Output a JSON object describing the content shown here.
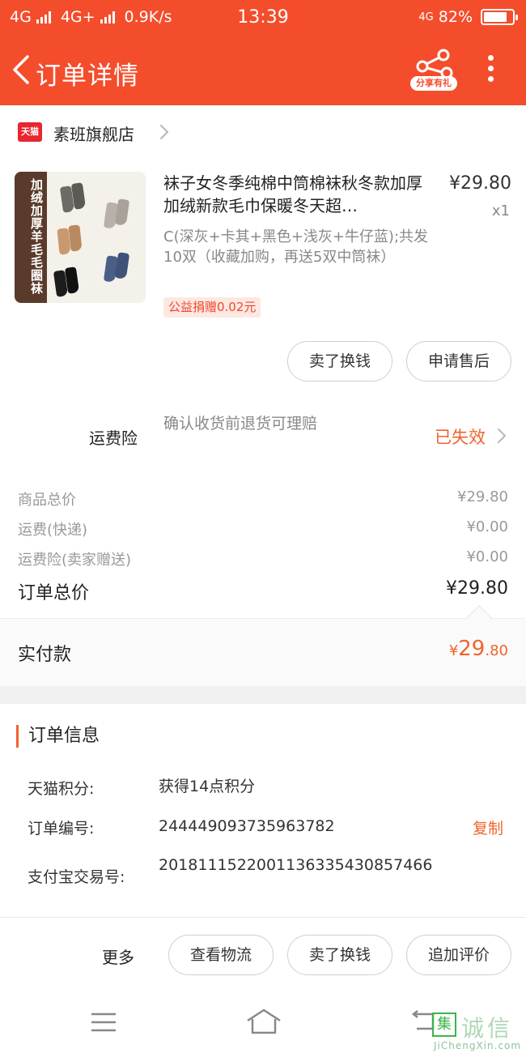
{
  "status_bar": {
    "network1": "4G",
    "network2": "4G+",
    "speed": "0.9K/s",
    "time": "13:39",
    "network3": "4G",
    "battery": "82%"
  },
  "nav": {
    "title": "订单详情",
    "share_label": "分享有礼",
    "back_icon": "chevron-left-icon",
    "share_icon": "share-icon",
    "more_icon": "more-vertical-icon"
  },
  "shop": {
    "logo_text": "天猫",
    "name": "素班旗舰店"
  },
  "product": {
    "image_banner": "加绒加厚羊毛毛圈袜",
    "title": "袜子女冬季纯棉中筒棉袜秋冬款加厚加绒新款毛巾保暖冬天超…",
    "price": "¥29.80",
    "quantity": "x1",
    "sku": "C(深灰+卡其+黑色+浅灰+牛仔蓝);共发10双（收藏加购，再送5双中筒袜）",
    "charity": "公益捐赠0.02元"
  },
  "product_actions": {
    "sell": "卖了换钱",
    "after_sale": "申请售后"
  },
  "insurance": {
    "label": "运费险",
    "description": "确认收货前退货可理赔",
    "status": "已失效"
  },
  "totals": {
    "goods_label": "商品总价",
    "goods_value": "¥29.80",
    "shipping_label": "运费(快递)",
    "shipping_value": "¥0.00",
    "insurance_label": "运费险(卖家赠送)",
    "insurance_value": "¥0.00",
    "order_total_label": "订单总价",
    "order_total_value": "¥29.80"
  },
  "paid": {
    "label": "实付款",
    "symbol": "¥",
    "integer": "29",
    "decimal": ".80"
  },
  "order_info": {
    "title": "订单信息",
    "points_label": "天猫积分:",
    "points_value": "获得14点积分",
    "order_no_label": "订单编号:",
    "order_no_value": "244449093735963782",
    "copy_label": "复制",
    "alipay_label": "支付宝交易号:",
    "alipay_value": "2018111522001136335430857466"
  },
  "bottom_actions": {
    "more": "更多",
    "logistics": "查看物流",
    "sell": "卖了换钱",
    "review": "追加评价"
  },
  "colors": {
    "brand": "#f44d2c",
    "accent": "#f0642d",
    "tmall_red": "#e8262e"
  },
  "watermark": {
    "box_char": "集",
    "chars": "诚信",
    "url": "JiChengXin.com"
  }
}
